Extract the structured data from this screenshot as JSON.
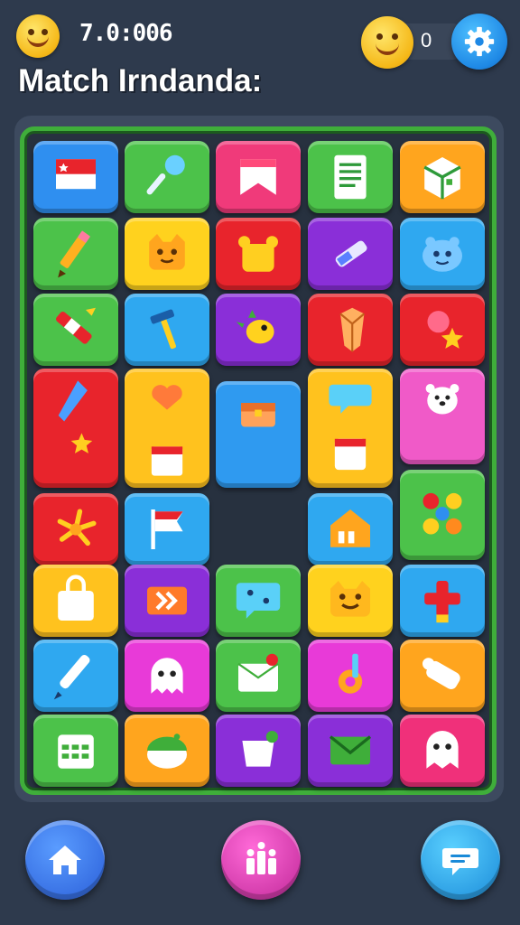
{
  "header": {
    "timer": "7.0:006",
    "title": "Match Irndanda:",
    "score": "0"
  },
  "icons": {
    "top_left": "smiley-face-icon",
    "coin": "smiley-coin-icon",
    "settings": "gear-icon"
  },
  "board": {
    "border_color": "#3fae3a",
    "tiles": [
      {
        "name": "flag-tile",
        "color": "#2f8ff0",
        "icon": "flag"
      },
      {
        "name": "pin-tile",
        "color": "#4cc24a",
        "icon": "pin"
      },
      {
        "name": "bookmark-tile",
        "color": "#f03a7a",
        "icon": "bookmark"
      },
      {
        "name": "document-tile",
        "color": "#4cc24a",
        "icon": "document"
      },
      {
        "name": "box-tile",
        "color": "#ffa51e",
        "icon": "box"
      },
      {
        "name": "pencil-tile",
        "color": "#4cc24a",
        "icon": "pencil"
      },
      {
        "name": "cat-face-tile",
        "color": "#ffd21e",
        "icon": "cat"
      },
      {
        "name": "bear-tile",
        "color": "#e8242c",
        "icon": "bear"
      },
      {
        "name": "syringe-tile",
        "color": "#8a2fd8",
        "icon": "syringe"
      },
      {
        "name": "monster-tile",
        "color": "#2fa8f0",
        "icon": "monster"
      },
      {
        "name": "crayon-tile",
        "color": "#4cc24a",
        "icon": "crayon"
      },
      {
        "name": "hammer-tile",
        "color": "#2fa8f0",
        "icon": "hammer"
      },
      {
        "name": "bird-tile",
        "color": "#8a2fd8",
        "icon": "bird"
      },
      {
        "name": "gem-tile",
        "color": "#e8242c",
        "icon": "gem"
      },
      {
        "name": "star-pin-tile",
        "color": "#e8242c",
        "icon": "starpin"
      },
      {
        "name": "pen-star-tile",
        "color": "#e8242c",
        "icon": "penstar"
      },
      {
        "name": "heart-calendar-tile",
        "color": "#ffc21e",
        "icon": "heartcal"
      },
      {
        "name": "treasure-box-tile",
        "color": "#2f9af0",
        "icon": "chest"
      },
      {
        "name": "chat-calendar-tile",
        "color": "#ffc21e",
        "icon": "chatcal"
      },
      {
        "name": "polar-bear-tile",
        "color": "#f05ac8",
        "icon": "polarbear"
      },
      {
        "name": "firework-tile",
        "color": "#e8242c",
        "icon": "firework"
      },
      {
        "name": "red-flag-tile",
        "color": "#2fa8f0",
        "icon": "redflag"
      },
      {
        "name": "house-tile",
        "color": "#2fa8f0",
        "icon": "house"
      },
      {
        "name": "buttons-tile",
        "color": "#4cc24a",
        "icon": "buttons"
      },
      {
        "name": "bag-tile",
        "color": "#ffc21e",
        "icon": "bag"
      },
      {
        "name": "arrows-tile",
        "color": "#8a2fd8",
        "icon": "arrows"
      },
      {
        "name": "dice-chat-tile",
        "color": "#4cc24a",
        "icon": "dicechat"
      },
      {
        "name": "smiley-cat-tile",
        "color": "#ffd21e",
        "icon": "smileycat"
      },
      {
        "name": "plus-tile",
        "color": "#2fa8f0",
        "icon": "plus"
      },
      {
        "name": "marker-tile",
        "color": "#2fa8f0",
        "icon": "marker"
      },
      {
        "name": "ghost-tile",
        "color": "#e83ad8",
        "icon": "ghost"
      },
      {
        "name": "envelope-dart-tile",
        "color": "#4cc24a",
        "icon": "envelopedart"
      },
      {
        "name": "gear-key-tile",
        "color": "#e83ad8",
        "icon": "gearkey"
      },
      {
        "name": "scroll-tile",
        "color": "#ffa51e",
        "icon": "scroll"
      },
      {
        "name": "calendar-grid-tile",
        "color": "#4cc24a",
        "icon": "grid"
      },
      {
        "name": "melon-tile",
        "color": "#ffa51e",
        "icon": "melon"
      },
      {
        "name": "cup-tile",
        "color": "#8a2fd8",
        "icon": "cup"
      },
      {
        "name": "envelope-tile",
        "color": "#8a2fd8",
        "icon": "envelope"
      },
      {
        "name": "chat-ghost-tile",
        "color": "#f0307a",
        "icon": "chatghost"
      }
    ]
  },
  "nav": [
    {
      "name": "home-button",
      "icon": "home-icon",
      "color": "#3a7af0"
    },
    {
      "name": "leaderboard-button",
      "icon": "leaderboard-icon",
      "color": "#e83ab8"
    },
    {
      "name": "chat-button",
      "icon": "chat-icon",
      "color": "#2fb0f0"
    }
  ]
}
